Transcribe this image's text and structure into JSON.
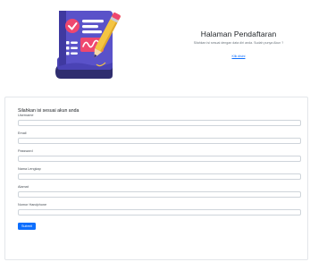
{
  "hero": {
    "title": "Halaman Pendaftaran",
    "subtitle": "Silahkan isi sesuai dengan data diri anda. Sudah punya Akun ?",
    "link_label": "Klik disini",
    "illustration_icon": "document-checklist-pencil-icon"
  },
  "form": {
    "title": "Silahkan isi sesuai akun anda",
    "fields": [
      {
        "label": "Username",
        "value": "",
        "placeholder": ""
      },
      {
        "label": "Email",
        "value": "",
        "placeholder": ""
      },
      {
        "label": "Password",
        "value": "",
        "placeholder": ""
      },
      {
        "label": "Nama Lengkap",
        "value": "",
        "placeholder": ""
      },
      {
        "label": "Alamat",
        "value": "",
        "placeholder": ""
      },
      {
        "label": "Nomor Handphone",
        "value": "",
        "placeholder": ""
      }
    ],
    "submit_label": "Submit"
  },
  "colors": {
    "primary": "#0d6efd",
    "illustration_navy": "#2f2d6f",
    "illustration_paper": "#5a52c9",
    "illustration_accent": "#ef476f",
    "illustration_pencil": "#f4c542"
  }
}
